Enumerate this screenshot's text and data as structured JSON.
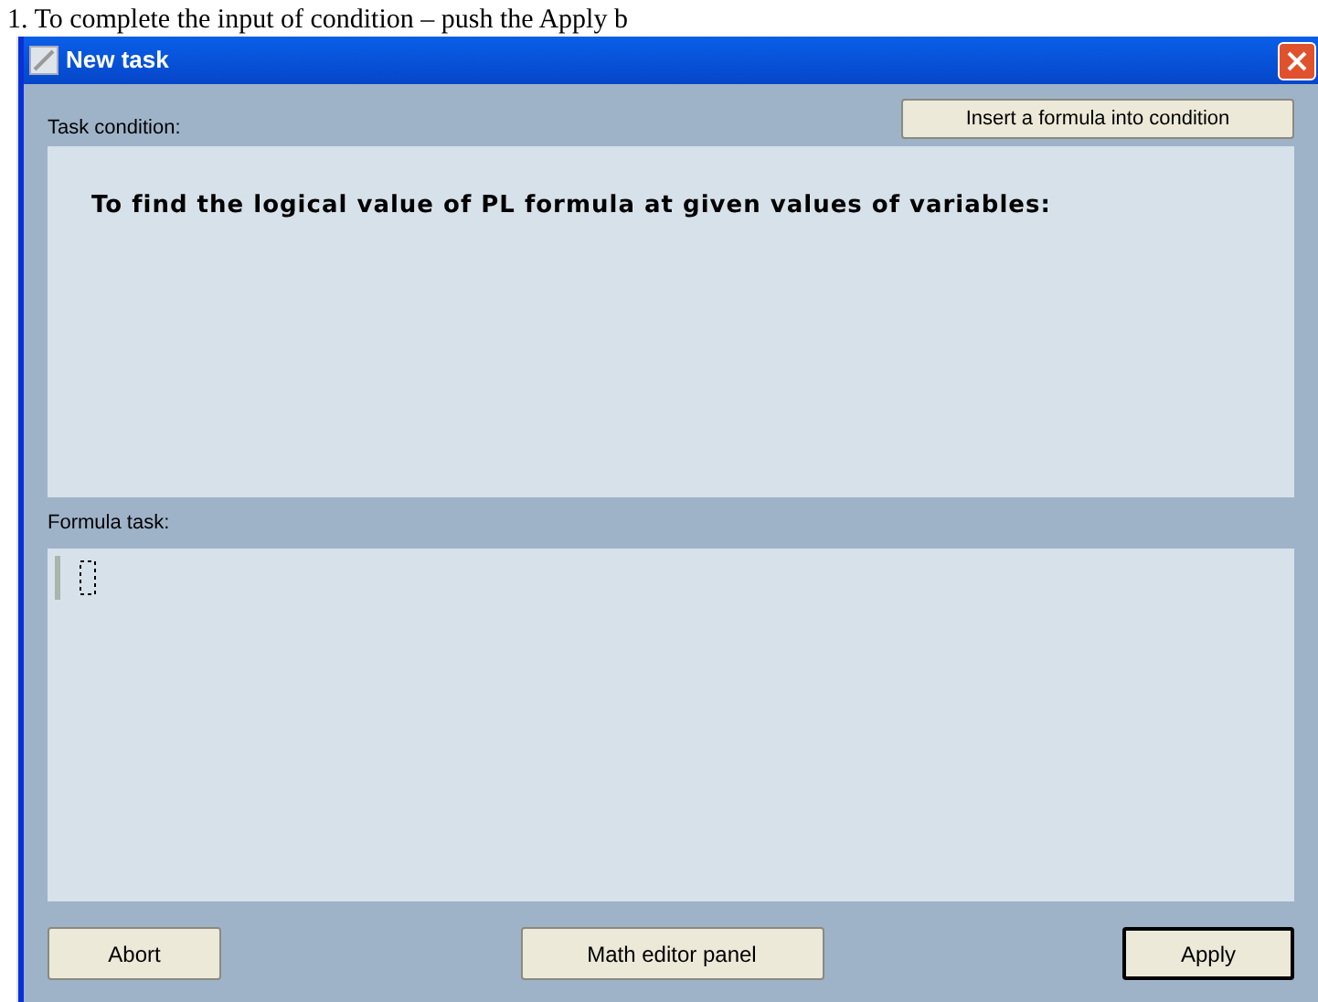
{
  "background_document": {
    "text": "1. To complete the input of condition – push the Apply b"
  },
  "window": {
    "title": "New task"
  },
  "task_condition": {
    "label": "Task condition:",
    "insert_button": "Insert a formula into condition",
    "text": "To find the logical value of PL formula at given values of variables:"
  },
  "formula_task": {
    "label": "Formula task:"
  },
  "buttons": [
    {
      "label": "Abort",
      "default": false
    },
    {
      "label": "Math editor panel",
      "default": false
    },
    {
      "label": "Apply",
      "default": true
    }
  ]
}
